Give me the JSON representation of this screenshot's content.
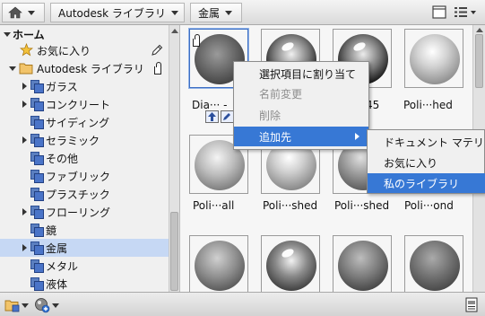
{
  "breadcrumb": {
    "home_icon": "home-icon",
    "items": [
      {
        "label": "Autodesk ライブラリ"
      },
      {
        "label": "金属"
      }
    ]
  },
  "view_toggle_icons": [
    "thumbnail-view-icon",
    "list-view-icon"
  ],
  "tree": {
    "root": {
      "label": "ホーム"
    },
    "favorites": {
      "label": "お気に入り",
      "icon": "star-icon"
    },
    "library": {
      "label": "Autodesk ライブラリ",
      "icon": "folder-icon"
    },
    "categories": [
      {
        "label": "ガラス",
        "expandable": true
      },
      {
        "label": "コンクリート",
        "expandable": true
      },
      {
        "label": "サイディング",
        "expandable": false
      },
      {
        "label": "セラミック",
        "expandable": true
      },
      {
        "label": "その他",
        "expandable": false
      },
      {
        "label": "ファブリック",
        "expandable": false
      },
      {
        "label": "プラスチック",
        "expandable": false
      },
      {
        "label": "フローリング",
        "expandable": true
      },
      {
        "label": "鏡",
        "expandable": false
      },
      {
        "label": "金属",
        "expandable": true,
        "selected": true
      },
      {
        "label": "メタル",
        "expandable": false
      },
      {
        "label": "液体",
        "expandable": false
      }
    ]
  },
  "materials": [
    {
      "caption": "Dia··· -",
      "selected": true,
      "tone": "rough-dark"
    },
    {
      "caption": "",
      "tone": "chrome"
    },
    {
      "caption": "45",
      "tone": "chrome"
    },
    {
      "caption": "Poli···hed",
      "tone": "polished"
    },
    {
      "caption": "Poli···all",
      "tone": "brushed"
    },
    {
      "caption": "Poli···shed",
      "tone": "polished"
    },
    {
      "caption": "Poli···shed",
      "tone": "polished-dark"
    },
    {
      "caption": "Poli···ond",
      "tone": "polished-dark"
    },
    {
      "caption": "",
      "tone": "rough"
    },
    {
      "caption": "",
      "tone": "chrome-dark"
    },
    {
      "caption": "",
      "tone": "rough-dark"
    },
    {
      "caption": "",
      "tone": "rough"
    }
  ],
  "context_menu": {
    "items": [
      {
        "label": "選択項目に割り当て",
        "disabled": false
      },
      {
        "label": "名前変更",
        "disabled": true
      },
      {
        "label": "削除",
        "disabled": true
      },
      {
        "label": "追加先",
        "has_submenu": true,
        "highlighted": true
      }
    ]
  },
  "submenu": {
    "items": [
      {
        "label": "ドキュメント マテリ"
      },
      {
        "label": "お気に入り"
      },
      {
        "label": "私のライブラリ",
        "highlighted": true
      }
    ]
  },
  "bottom_toolbar": {
    "left_icons": [
      "library-manage-icon",
      "material-create-icon"
    ],
    "right_icon": "material-editor-icon"
  },
  "colors": {
    "selection_bg": "#c6d8f4",
    "menu_highlight": "#3778d5",
    "panel_bg": "#f0f0f0"
  }
}
